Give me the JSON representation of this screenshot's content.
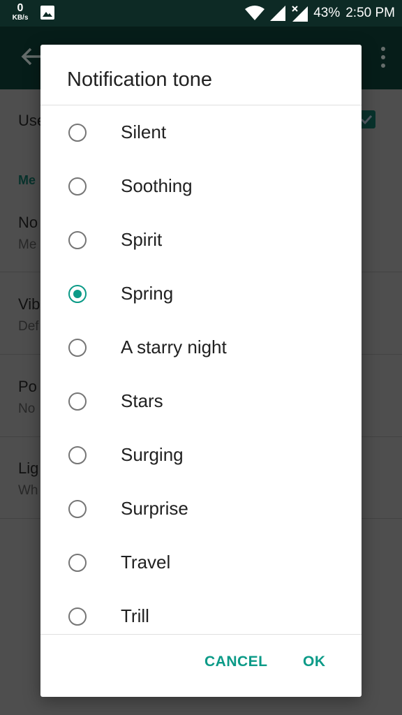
{
  "status_bar": {
    "speed_value": "0",
    "speed_unit": "KB/s",
    "battery": "43%",
    "time": "2:50 PM",
    "icons": [
      "image-icon",
      "wifi-icon",
      "signal-icon",
      "signal-no-data-icon"
    ]
  },
  "background": {
    "row1_text": "Use",
    "section_label": "Me",
    "row2_title": "No",
    "row2_sub": "Me",
    "row3_title": "Vib",
    "row3_sub": "Def",
    "row4_title": "Po",
    "row4_sub": "No",
    "row5_title": "Lig",
    "row5_sub": "Wh"
  },
  "dialog": {
    "title": "Notification tone",
    "options": [
      {
        "label": "Silent",
        "selected": false
      },
      {
        "label": "Soothing",
        "selected": false
      },
      {
        "label": "Spirit",
        "selected": false
      },
      {
        "label": "Spring",
        "selected": true
      },
      {
        "label": "A starry night",
        "selected": false
      },
      {
        "label": "Stars",
        "selected": false
      },
      {
        "label": "Surging",
        "selected": false
      },
      {
        "label": "Surprise",
        "selected": false
      },
      {
        "label": "Travel",
        "selected": false
      },
      {
        "label": "Trill",
        "selected": false
      }
    ],
    "cancel_label": "CANCEL",
    "ok_label": "OK"
  },
  "colors": {
    "accent": "#0b9a87",
    "status_bar": "#0d2a25",
    "app_bar": "#0b352e"
  }
}
